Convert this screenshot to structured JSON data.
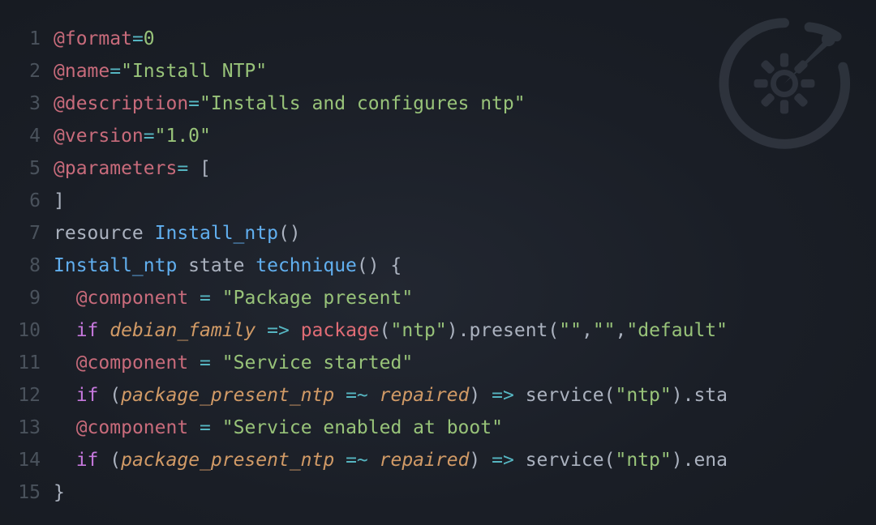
{
  "lines": [
    {
      "n": "1",
      "indent": 0,
      "tokens": [
        [
          "at",
          "@format"
        ],
        [
          "eq",
          "="
        ],
        [
          "str",
          "0"
        ]
      ]
    },
    {
      "n": "2",
      "indent": 0,
      "tokens": [
        [
          "at",
          "@name"
        ],
        [
          "eq",
          "="
        ],
        [
          "str",
          "\"Install NTP\""
        ]
      ]
    },
    {
      "n": "3",
      "indent": 0,
      "tokens": [
        [
          "at",
          "@description"
        ],
        [
          "eq",
          "="
        ],
        [
          "str",
          "\"Installs and configures ntp\""
        ]
      ]
    },
    {
      "n": "4",
      "indent": 0,
      "tokens": [
        [
          "at",
          "@version"
        ],
        [
          "eq",
          "="
        ],
        [
          "str",
          "\"1.0\""
        ]
      ]
    },
    {
      "n": "5",
      "indent": 0,
      "tokens": [
        [
          "at",
          "@parameters"
        ],
        [
          "eq",
          "="
        ],
        [
          "txt",
          " ["
        ]
      ]
    },
    {
      "n": "6",
      "indent": 0,
      "tokens": [
        [
          "txt",
          "]"
        ]
      ]
    },
    {
      "n": "7",
      "indent": 0,
      "tokens": [
        [
          "txt",
          "resource "
        ],
        [
          "def",
          "Install_ntp"
        ],
        [
          "txt",
          "()"
        ]
      ]
    },
    {
      "n": "8",
      "indent": 0,
      "tokens": [
        [
          "def",
          "Install_ntp"
        ],
        [
          "txt",
          " state "
        ],
        [
          "def",
          "technique"
        ],
        [
          "txt",
          "() {"
        ]
      ]
    },
    {
      "n": "9",
      "indent": 1,
      "tokens": [
        [
          "at",
          "@component"
        ],
        [
          "txt",
          " "
        ],
        [
          "eq",
          "="
        ],
        [
          "txt",
          " "
        ],
        [
          "str",
          "\"Package present\""
        ]
      ]
    },
    {
      "n": "10",
      "indent": 1,
      "tokens": [
        [
          "kw",
          "if"
        ],
        [
          "txt",
          " "
        ],
        [
          "id",
          "debian_family"
        ],
        [
          "txt",
          " "
        ],
        [
          "eq",
          "=>"
        ],
        [
          "txt",
          " "
        ],
        [
          "fn",
          "package"
        ],
        [
          "txt",
          "("
        ],
        [
          "str",
          "\"ntp\""
        ],
        [
          "txt",
          ")."
        ],
        [
          "call",
          "present"
        ],
        [
          "txt",
          "("
        ],
        [
          "str",
          "\"\""
        ],
        [
          "txt",
          ","
        ],
        [
          "str",
          "\"\""
        ],
        [
          "txt",
          ","
        ],
        [
          "str",
          "\"default\""
        ]
      ]
    },
    {
      "n": "11",
      "indent": 1,
      "tokens": [
        [
          "at",
          "@component"
        ],
        [
          "txt",
          " "
        ],
        [
          "eq",
          "="
        ],
        [
          "txt",
          " "
        ],
        [
          "str",
          "\"Service started\""
        ]
      ]
    },
    {
      "n": "12",
      "indent": 1,
      "tokens": [
        [
          "kw",
          "if"
        ],
        [
          "txt",
          " ("
        ],
        [
          "id",
          "package_present_ntp"
        ],
        [
          "txt",
          " "
        ],
        [
          "eq",
          "=~"
        ],
        [
          "txt",
          " "
        ],
        [
          "id",
          "repaired"
        ],
        [
          "txt",
          ") "
        ],
        [
          "eq",
          "=>"
        ],
        [
          "txt",
          " "
        ],
        [
          "call",
          "service"
        ],
        [
          "txt",
          "("
        ],
        [
          "str",
          "\"ntp\""
        ],
        [
          "txt",
          ")."
        ],
        [
          "call",
          "sta"
        ]
      ]
    },
    {
      "n": "13",
      "indent": 1,
      "tokens": [
        [
          "at",
          "@component"
        ],
        [
          "txt",
          " "
        ],
        [
          "eq",
          "="
        ],
        [
          "txt",
          " "
        ],
        [
          "str",
          "\"Service enabled at boot\""
        ]
      ]
    },
    {
      "n": "14",
      "indent": 1,
      "tokens": [
        [
          "kw",
          "if"
        ],
        [
          "txt",
          " ("
        ],
        [
          "id",
          "package_present_ntp"
        ],
        [
          "txt",
          " "
        ],
        [
          "eq",
          "=~"
        ],
        [
          "txt",
          " "
        ],
        [
          "id",
          "repaired"
        ],
        [
          "txt",
          ") "
        ],
        [
          "eq",
          "=>"
        ],
        [
          "txt",
          " "
        ],
        [
          "call",
          "service"
        ],
        [
          "txt",
          "("
        ],
        [
          "str",
          "\"ntp\""
        ],
        [
          "txt",
          ")."
        ],
        [
          "call",
          "ena"
        ]
      ]
    },
    {
      "n": "15",
      "indent": 0,
      "tokens": [
        [
          "txt",
          "}"
        ]
      ]
    }
  ],
  "watermark_icon": "gear-gauge-icon"
}
